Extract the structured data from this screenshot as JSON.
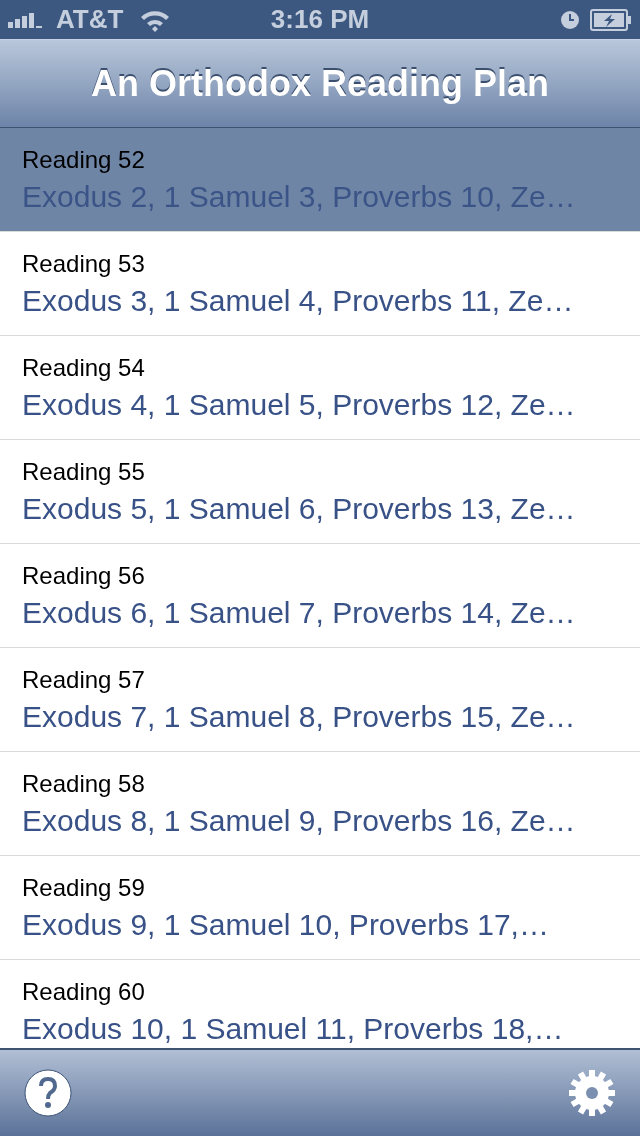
{
  "status_bar": {
    "carrier": "AT&T",
    "time": "3:16 PM"
  },
  "nav_bar": {
    "title": "An Orthodox Reading Plan"
  },
  "readings": [
    {
      "title": "Reading 52",
      "passages": "Exodus 2, 1 Samuel 3, Proverbs 10, Ze…",
      "selected": true
    },
    {
      "title": "Reading 53",
      "passages": "Exodus 3, 1 Samuel 4, Proverbs 11, Ze…",
      "selected": false
    },
    {
      "title": "Reading 54",
      "passages": "Exodus 4, 1 Samuel 5, Proverbs 12, Ze…",
      "selected": false
    },
    {
      "title": "Reading 55",
      "passages": "Exodus 5, 1 Samuel 6, Proverbs 13, Ze…",
      "selected": false
    },
    {
      "title": "Reading 56",
      "passages": "Exodus 6, 1 Samuel 7, Proverbs 14, Ze…",
      "selected": false
    },
    {
      "title": "Reading 57",
      "passages": "Exodus 7, 1 Samuel 8, Proverbs 15, Ze…",
      "selected": false
    },
    {
      "title": "Reading 58",
      "passages": "Exodus 8, 1 Samuel 9, Proverbs 16, Ze…",
      "selected": false
    },
    {
      "title": "Reading 59",
      "passages": "Exodus 9, 1 Samuel 10, Proverbs 17,…",
      "selected": false
    },
    {
      "title": "Reading 60",
      "passages": "Exodus 10, 1 Samuel 11, Proverbs 18,…",
      "selected": false
    }
  ]
}
